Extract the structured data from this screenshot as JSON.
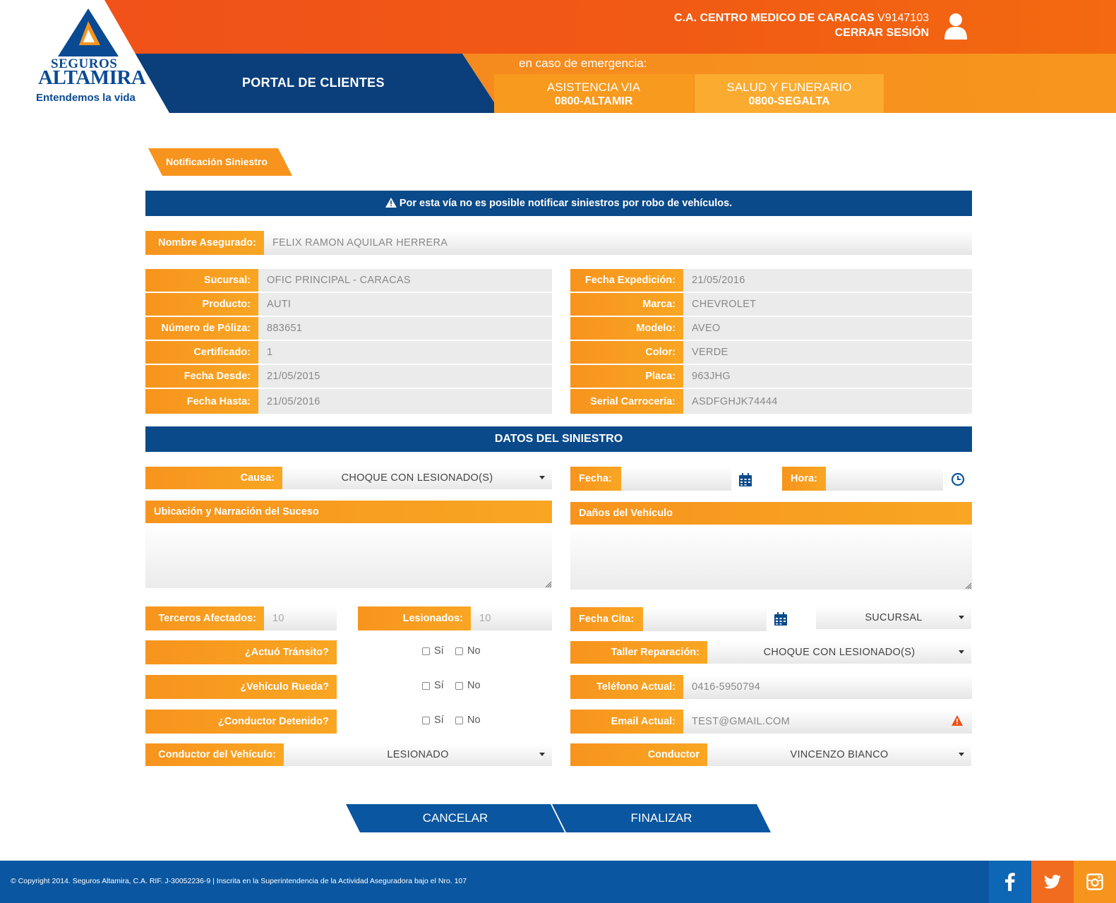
{
  "header": {
    "logo_line1": "SEGUROS",
    "logo_line2": "ALTAMIRA",
    "logo_tagline": "Entendemos la vida",
    "company_name": "C.A. CENTRO MEDICO DE CARACAS",
    "company_rif": "V9147103",
    "logout_label": "CERRAR SESIÓN",
    "portal_title": "PORTAL DE CLIENTES",
    "emergency_label": "en caso de emergencia:",
    "emergency": [
      {
        "name": "ASISTENCIA VIA",
        "phone": "0800-ALTAMIR"
      },
      {
        "name": "SALUD Y FUNERARIO",
        "phone": "0800-SEGALTA"
      }
    ]
  },
  "page": {
    "tab_title": "Notificación Siniestro",
    "warning": "Por esta vía no es posible notificar siniestros por robo de vehículos."
  },
  "insured": {
    "label": "Nombre Asegurado:",
    "value": "FELIX RAMON AQUILAR HERRERA"
  },
  "policy_left": [
    {
      "label": "Sucursal:",
      "value": "OFIC PRINCIPAL - CARACAS"
    },
    {
      "label": "Producto:",
      "value": "AUTI"
    },
    {
      "label": "Número de Póliza:",
      "value": "883651"
    },
    {
      "label": "Certificado:",
      "value": "1"
    },
    {
      "label": "Fecha Desde:",
      "value": "21/05/2015"
    },
    {
      "label": "Fecha Hasta:",
      "value": "21/05/2016"
    }
  ],
  "policy_right": [
    {
      "label": "Fecha Expedición:",
      "value": "21/05/2016"
    },
    {
      "label": "Marca:",
      "value": "CHEVROLET"
    },
    {
      "label": "Modelo:",
      "value": "AVEO"
    },
    {
      "label": "Color:",
      "value": "VERDE"
    },
    {
      "label": "Placa:",
      "value": "963JHG"
    },
    {
      "label": "Serial Carrocería:",
      "value": "ASDFGHJK74444"
    }
  ],
  "siniestro": {
    "title": "DATOS DEL SINIESTRO",
    "causa_label": "Causa:",
    "causa_value": "CHOQUE CON LESIONADO(S)",
    "fecha_label": "Fecha:",
    "fecha_value": "",
    "hora_label": "Hora:",
    "hora_value": "",
    "ubicacion_label": "Ubicación y Narración del Suceso",
    "danos_label": "Daños del Vehículo",
    "terceros_label": "Terceros Afectados:",
    "terceros_placeholder": "10",
    "lesionados_label": "Lesionados:",
    "lesionados_placeholder": "10",
    "fecha_cita_label": "Fecha Cita:",
    "fecha_cita_value": "",
    "sucursal_select": "SUCURSAL",
    "transito_label": "¿Actuó Tránsito?",
    "rueda_label": "¿Vehículo Rueda?",
    "detenido_label": "¿Conductor Detenido?",
    "si_label": "Sí",
    "no_label": "No",
    "taller_label": "Taller Reparación:",
    "taller_value": "CHOQUE CON LESIONADO(S)",
    "telefono_label": "Teléfono Actual:",
    "telefono_value": "0416-5950794",
    "email_label": "Email Actual:",
    "email_value": "TEST@GMAIL.COM",
    "conductor_vehiculo_label": "Conductor del Vehículo:",
    "conductor_vehiculo_value": "LESIONADO",
    "conductor_label": "Conductor",
    "conductor_value": "VINCENZO BIANCO"
  },
  "buttons": {
    "cancel": "CANCELAR",
    "finish": "FINALIZAR"
  },
  "footer": {
    "copyright": "© Copyright 2014. Seguros Altamira, C.A. RIF. J-30052236-9 | Inscrita en la Superintendencia de la Actividad Aseguradora bajo el Nro. 107",
    "social": [
      "facebook-icon",
      "twitter-icon",
      "instagram-icon"
    ]
  },
  "colors": {
    "orange": "#f7941d",
    "deep_orange": "#f0501a",
    "blue": "#0a4a8a",
    "footer_blue": "#0a56a0"
  }
}
